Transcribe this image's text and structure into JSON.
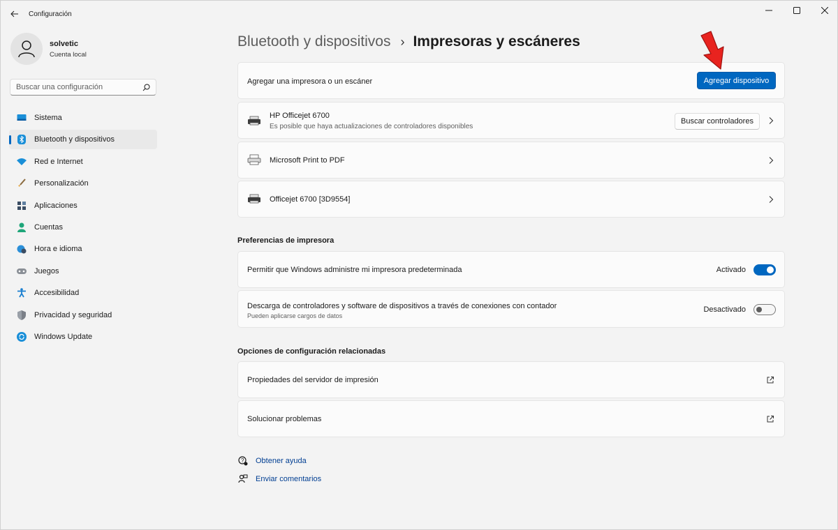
{
  "window": {
    "title": "Configuración"
  },
  "profile": {
    "name": "solvetic",
    "account_type": "Cuenta local"
  },
  "search": {
    "placeholder": "Buscar una configuración"
  },
  "sidebar": {
    "items": [
      {
        "label": "Sistema",
        "icon": "system-icon",
        "active": false
      },
      {
        "label": "Bluetooth y dispositivos",
        "icon": "bluetooth-icon",
        "active": true
      },
      {
        "label": "Red e Internet",
        "icon": "wifi-icon",
        "active": false
      },
      {
        "label": "Personalización",
        "icon": "brush-icon",
        "active": false
      },
      {
        "label": "Aplicaciones",
        "icon": "apps-icon",
        "active": false
      },
      {
        "label": "Cuentas",
        "icon": "person-icon",
        "active": false
      },
      {
        "label": "Hora e idioma",
        "icon": "globe-clock-icon",
        "active": false
      },
      {
        "label": "Juegos",
        "icon": "gamepad-icon",
        "active": false
      },
      {
        "label": "Accesibilidad",
        "icon": "accessibility-icon",
        "active": false
      },
      {
        "label": "Privacidad y seguridad",
        "icon": "shield-icon",
        "active": false
      },
      {
        "label": "Windows Update",
        "icon": "update-icon",
        "active": false
      }
    ]
  },
  "breadcrumb": {
    "parent": "Bluetooth y dispositivos",
    "separator": "›",
    "current": "Impresoras y escáneres"
  },
  "add_device": {
    "label": "Agregar una impresora o un escáner",
    "button": "Agregar dispositivo"
  },
  "devices": [
    {
      "name": "HP Officejet 6700",
      "sub": "Es posible que haya actualizaciones de controladores disponibles",
      "button": "Buscar controladores"
    },
    {
      "name": "Microsoft Print to PDF"
    },
    {
      "name": "Officejet 6700 [3D9554]"
    }
  ],
  "printer_prefs": {
    "title": "Preferencias de impresora",
    "items": [
      {
        "label": "Permitir que Windows administre mi impresora predeterminada",
        "state_label": "Activado",
        "on": true
      },
      {
        "label": "Descarga de controladores y software de dispositivos a través de conexiones con contador",
        "sub": "Pueden aplicarse cargos de datos",
        "state_label": "Desactivado",
        "on": false
      }
    ]
  },
  "related": {
    "title": "Opciones de configuración relacionadas",
    "items": [
      {
        "label": "Propiedades del servidor de impresión"
      },
      {
        "label": "Solucionar problemas"
      }
    ]
  },
  "help": {
    "get_help": "Obtener ayuda",
    "feedback": "Enviar comentarios"
  },
  "colors": {
    "accent": "#0067c0",
    "annotation_arrow": "#e8231f"
  }
}
